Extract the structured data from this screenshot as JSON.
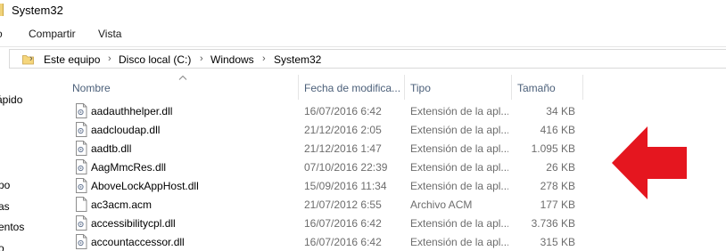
{
  "window": {
    "title": "System32"
  },
  "ribbon": {
    "tabs": [
      "o",
      "Compartir",
      "Vista"
    ]
  },
  "address": {
    "crumbs": [
      "Este equipo",
      "Disco local (C:)",
      "Windows",
      "System32"
    ]
  },
  "nav": {
    "items": [
      "ápido",
      "po",
      "as",
      "entos",
      "o"
    ]
  },
  "columns": {
    "name": "Nombre",
    "date": "Fecha de modifica...",
    "type": "Tipo",
    "size": "Tamaño"
  },
  "files": [
    {
      "name": "aadauthhelper.dll",
      "date": "16/07/2016 6:42",
      "type": "Extensión de la apl...",
      "size": "34 KB"
    },
    {
      "name": "aadcloudap.dll",
      "date": "21/12/2016 2:05",
      "type": "Extensión de la apl...",
      "size": "416 KB"
    },
    {
      "name": "aadtb.dll",
      "date": "21/12/2016 1:47",
      "type": "Extensión de la apl...",
      "size": "1.095 KB"
    },
    {
      "name": "AagMmcRes.dll",
      "date": "07/10/2016 22:39",
      "type": "Extensión de la apl...",
      "size": "26 KB"
    },
    {
      "name": "AboveLockAppHost.dll",
      "date": "15/09/2016 11:34",
      "type": "Extensión de la apl...",
      "size": "278 KB"
    },
    {
      "name": "ac3acm.acm",
      "date": "21/07/2012 6:55",
      "type": "Archivo ACM",
      "size": "177 KB"
    },
    {
      "name": "accessibilitycpl.dll",
      "date": "16/07/2016 6:42",
      "type": "Extensión de la apl...",
      "size": "3.736 KB"
    },
    {
      "name": "accountaccessor.dll",
      "date": "16/07/2016 6:42",
      "type": "Extensión de la apl...",
      "size": "315 KB"
    }
  ],
  "icons": {
    "file": "dll-file-icon",
    "folder": "folder-icon",
    "annotation": "red-left-arrow"
  },
  "colors": {
    "annotation_arrow": "#e5161f",
    "header_text": "#4c607a",
    "secondary_text": "#6d6d6d"
  }
}
